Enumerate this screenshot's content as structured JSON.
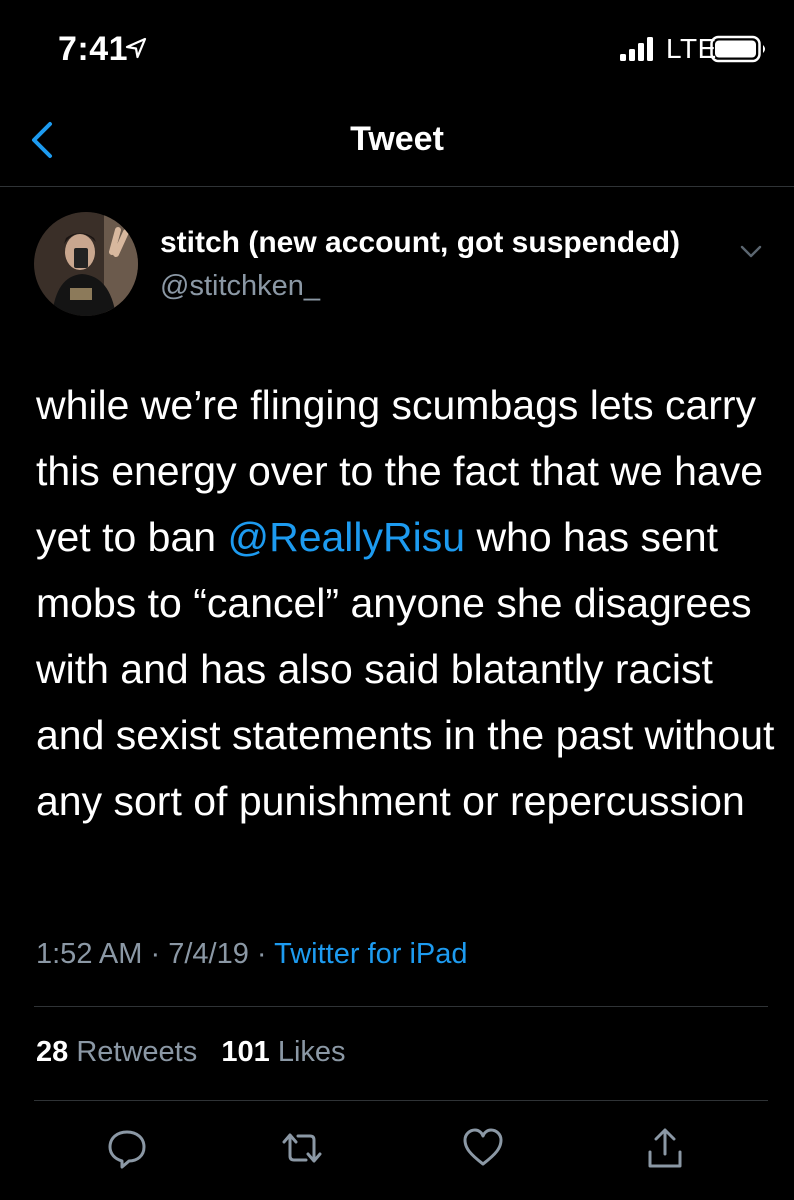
{
  "status_bar": {
    "time": "7:41",
    "carrier": "LTE"
  },
  "nav": {
    "title": "Tweet"
  },
  "author": {
    "name": "stitch (new account, got suspended)",
    "handle": "@stitchken_"
  },
  "tweet": {
    "text_before_mention": "while we’re flinging scumbags lets carry this energy over to the fact that we have yet to ban ",
    "mention": "@ReallyRisu",
    "text_after_mention": " who has sent mobs to “cancel” anyone she disagrees with and has also said blatantly racist and sexist statements in the past without any sort of punishment or repercussion"
  },
  "meta": {
    "time": "1:52 AM",
    "date": "7/4/19",
    "separator": "·",
    "source": "Twitter for iPad"
  },
  "stats": {
    "retweets_count": "28",
    "retweets_label": "Retweets",
    "likes_count": "101",
    "likes_label": "Likes"
  },
  "actions": [
    "reply-icon",
    "retweet-icon",
    "like-icon",
    "share-icon"
  ],
  "colors": {
    "background": "#000000",
    "accent": "#1d9bf0",
    "secondary_text": "#8b98a5",
    "divider": "#2f3336"
  }
}
